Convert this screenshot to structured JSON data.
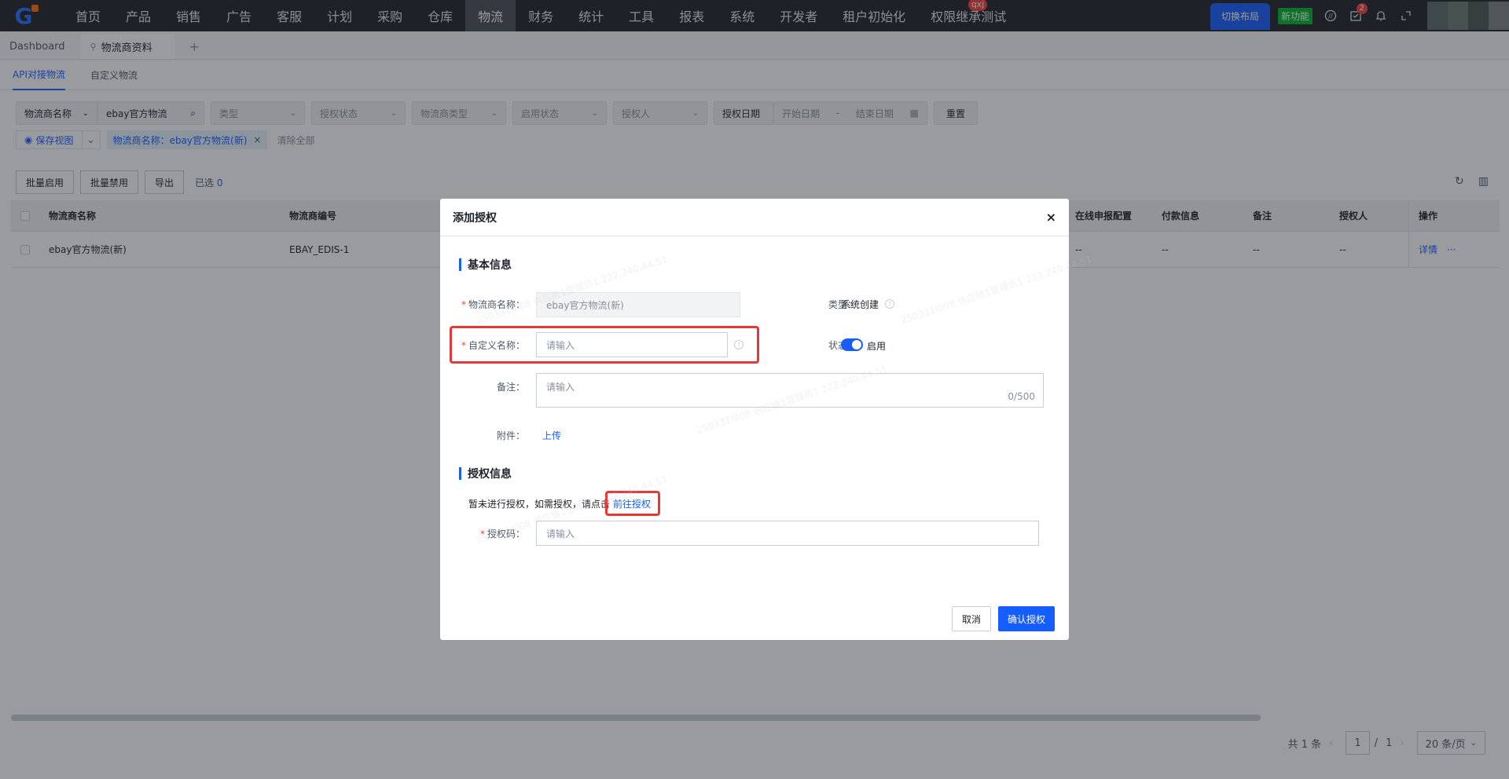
{
  "nav": {
    "items": [
      "首页",
      "产品",
      "销售",
      "广告",
      "客服",
      "计划",
      "采购",
      "仓库",
      "物流",
      "财务",
      "统计",
      "工具",
      "报表",
      "系统",
      "开发者",
      "租户初始化",
      "权限继承测试"
    ],
    "active": "物流",
    "badge_text": "qxj",
    "switch_layout": "切换布局",
    "new_feature": "新功能",
    "notif_count": "2"
  },
  "tabs": {
    "dashboard": "Dashboard",
    "active": "物流商资料",
    "plus": "+"
  },
  "subtabs": [
    "API对接物流",
    "自定义物流"
  ],
  "filters": {
    "field_select": "物流商名称",
    "field_value": "ebay官方物流",
    "type": "类型",
    "auth_status": "授权状态",
    "carrier_type": "物流商类型",
    "enable_status": "启用状态",
    "authorizer": "授权人",
    "auth_date": "授权日期",
    "start_date": "开始日期",
    "date_sep": "-",
    "end_date": "结束日期",
    "reset": "重置"
  },
  "row2": {
    "save_view": "保存视图",
    "tag": "物流商名称：ebay官方物流(新)",
    "clear_all": "清除全部"
  },
  "actions": {
    "batch_enable": "批量启用",
    "batch_disable": "批量禁用",
    "export": "导出",
    "selected_label": "已选",
    "selected_count": "0"
  },
  "table": {
    "headers": [
      "物流商名称",
      "物流商编号",
      "在线申报配置",
      "付款信息",
      "备注",
      "授权人",
      "操作"
    ],
    "rows": [
      {
        "name": "ebay官方物流(新)",
        "code": "EBAY_EDIS-1",
        "online": "--",
        "payment": "--",
        "remark": "--",
        "authorizer": "--",
        "detail": "详情",
        "more": "···"
      }
    ]
  },
  "pager": {
    "total": "共 1 条",
    "prev": "‹",
    "page": "1",
    "sep": "/",
    "pages": "1",
    "next": "›",
    "size": "20 条/页"
  },
  "modal": {
    "title": "添加授权",
    "close": "×",
    "section_basic": "基本信息",
    "carrier_name_label": "物流商名称：",
    "carrier_name_value": "ebay官方物流(新)",
    "type_label": "类型：",
    "type_value": "系统创建",
    "custom_name_label": "自定义名称：",
    "custom_name_placeholder": "请输入",
    "status_label": "状态：",
    "status_value": "启用",
    "remark_label": "备注：",
    "remark_placeholder": "请输入",
    "remark_counter": "0/500",
    "attach_label": "附件：",
    "upload": "上传",
    "section_auth": "授权信息",
    "auth_hint": "暂未进行授权，如需授权，请点击",
    "auth_link": "前往授权",
    "auth_code_label": "授权码：",
    "auth_code_placeholder": "请输入",
    "cancel": "取消",
    "confirm": "确认授权"
  },
  "watermark": "250331I008 供应链1管理员1 222.240.44.51",
  "colors": {
    "primary": "#165dff",
    "nav_bg": "#1f2128",
    "highlight": "#e53935",
    "new_feature": "#00b42a"
  }
}
